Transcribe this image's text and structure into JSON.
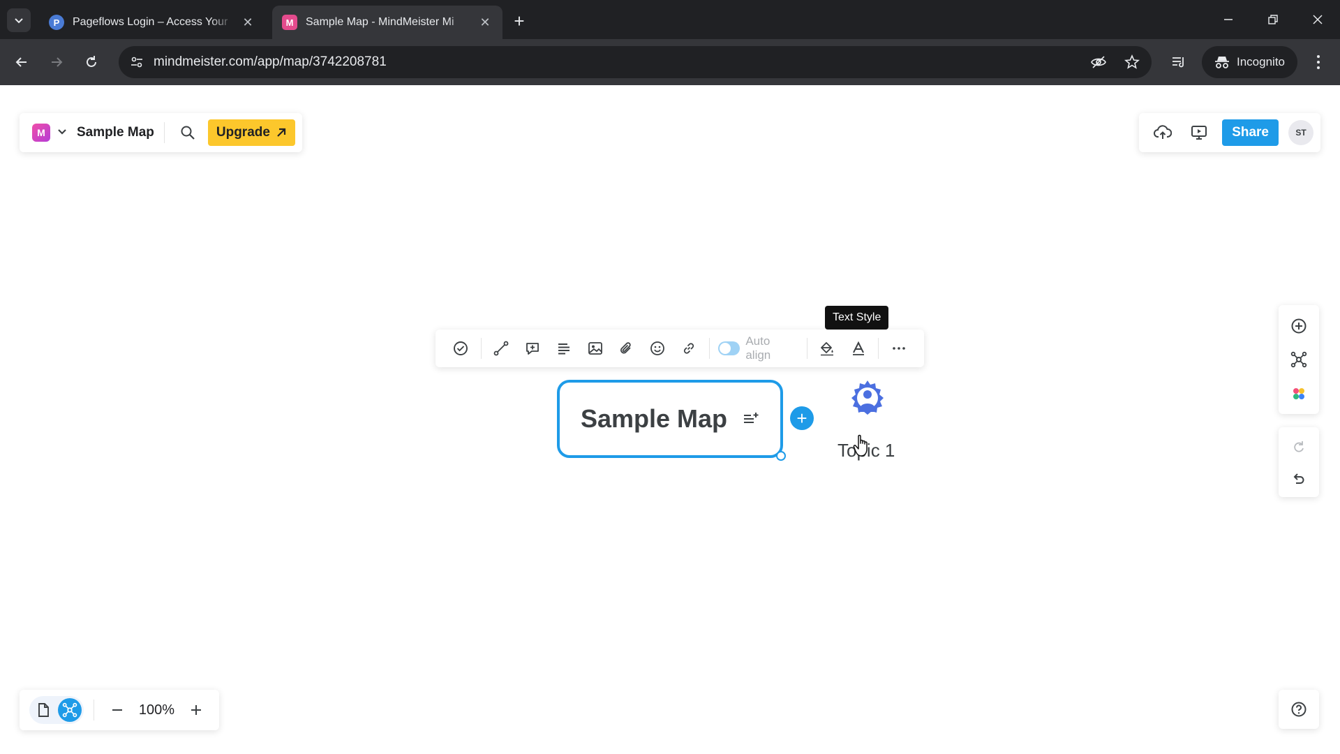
{
  "browser": {
    "tabs": [
      {
        "title": "Pageflows Login – Access Your",
        "favicon_letter": "P",
        "active": false
      },
      {
        "title": "Sample Map - MindMeister Mi",
        "favicon_letter": "M",
        "active": true
      }
    ],
    "url": "mindmeister.com/app/map/3742208781",
    "incognito_label": "Incognito"
  },
  "app": {
    "logo_letter": "M",
    "map_title": "Sample Map",
    "upgrade_label": "Upgrade",
    "share_label": "Share",
    "avatar_initials": "ST",
    "zoom": "100%"
  },
  "toolbar": {
    "auto_align_label": "Auto align",
    "tooltip": "Text Style"
  },
  "map": {
    "root_title": "Sample Map",
    "topic_label": "Topic 1"
  },
  "colors": {
    "accent": "#1e9be8",
    "upgrade": "#fcc72c",
    "topic_icon": "#4b6fe0"
  }
}
